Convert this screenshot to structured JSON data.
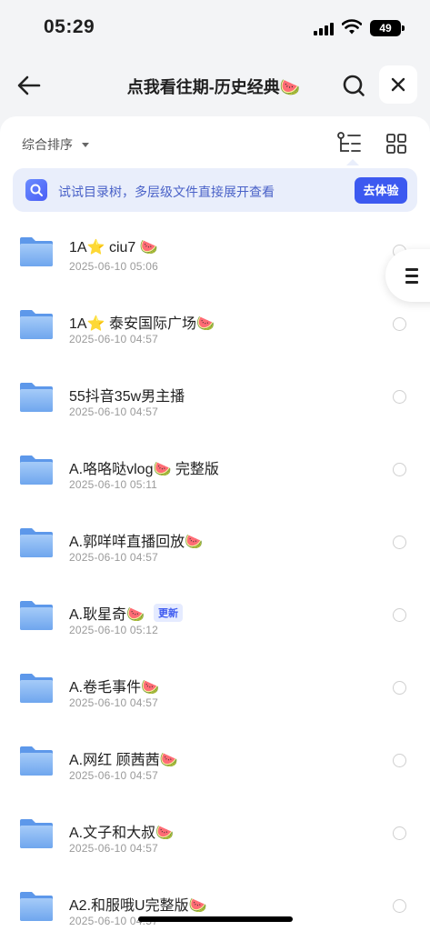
{
  "status": {
    "time": "05:29",
    "battery": "49"
  },
  "nav": {
    "title": "点我看往期-历史经典🍉"
  },
  "sort": {
    "label": "综合排序"
  },
  "banner": {
    "text": "试试目录树，多层级文件直接展开查看",
    "button": "去体验"
  },
  "files": [
    {
      "name": "1A⭐ ciu7 🍉",
      "date": "2025-06-10 05:06",
      "badge": ""
    },
    {
      "name": "1A⭐ 泰安国际广场🍉",
      "date": "2025-06-10 04:57",
      "badge": ""
    },
    {
      "name": "55抖音35w男主播",
      "date": "2025-06-10 04:57",
      "badge": ""
    },
    {
      "name": "A.咯咯哒vlog🍉 完整版",
      "date": "2025-06-10 05:11",
      "badge": ""
    },
    {
      "name": "A.郭咩咩直播回放🍉",
      "date": "2025-06-10 04:57",
      "badge": ""
    },
    {
      "name": "A.耿星奇🍉",
      "date": "2025-06-10 05:12",
      "badge": "更新"
    },
    {
      "name": "A.卷毛事件🍉",
      "date": "2025-06-10 04:57",
      "badge": ""
    },
    {
      "name": "A.网红 顾茜茜🍉",
      "date": "2025-06-10 04:57",
      "badge": ""
    },
    {
      "name": "A.文子和大叔🍉",
      "date": "2025-06-10 04:57",
      "badge": ""
    },
    {
      "name": "A2.和服哦U完整版🍉",
      "date": "2025-06-10 04:57",
      "badge": ""
    }
  ],
  "icons": {
    "back": "arrow-left-icon",
    "search": "search-icon",
    "close": "close-icon",
    "tree": "tree-view-icon",
    "grid": "grid-view-icon",
    "folder": "folder-icon",
    "menu": "menu-icon"
  },
  "colors": {
    "accent": "#3c59f0",
    "banner_bg": "#e9eefb",
    "folder": "#7fb0f3"
  }
}
